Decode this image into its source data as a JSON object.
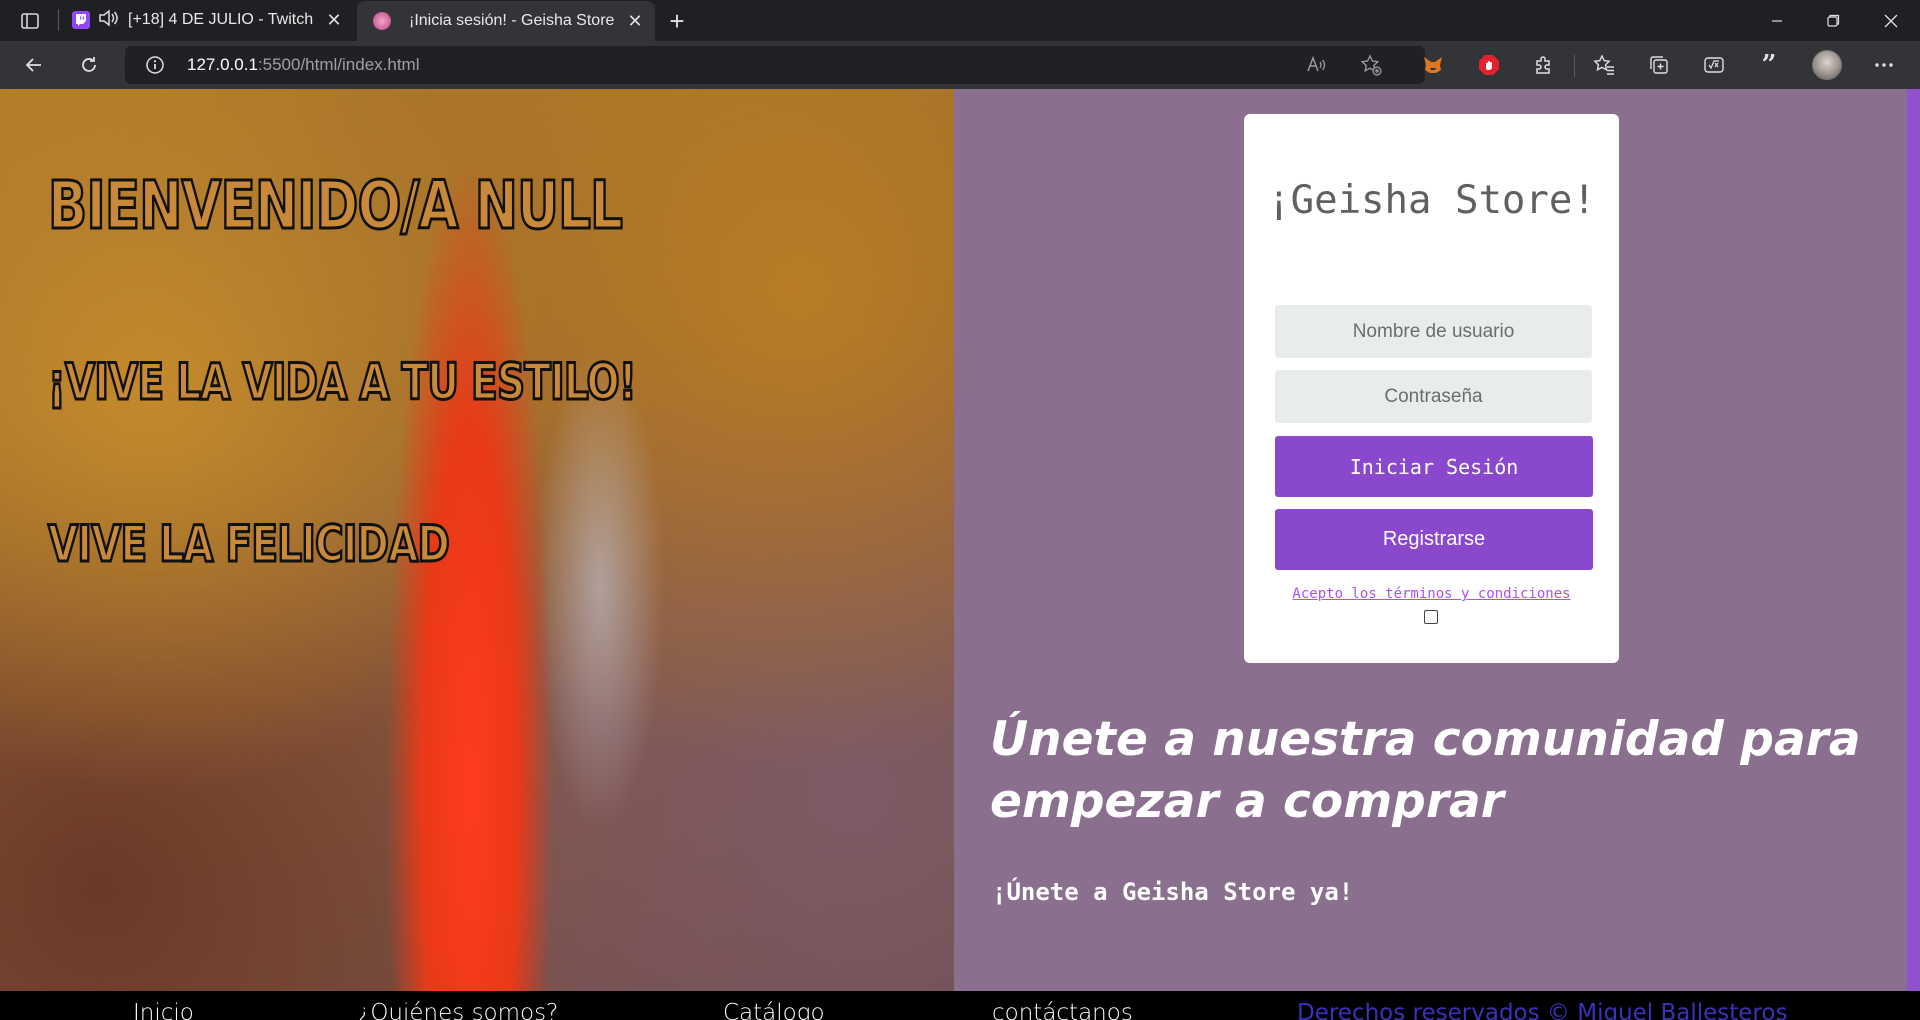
{
  "browser": {
    "tabs": [
      {
        "title": "[+18] 4 DE JULIO - Twitch",
        "favicon": "twitch-icon",
        "audio": true,
        "active": false
      },
      {
        "title": "¡Inicia sesión! - Geisha Store",
        "favicon": "geisha-store-favicon",
        "active": true
      }
    ],
    "address": {
      "host": "127.0.0.1",
      "rest": ":5500/html/index.html"
    },
    "colors": {
      "chrome_bg": "#1f2023",
      "toolbar_bg": "#333437",
      "address_bg": "#202124"
    }
  },
  "hero": {
    "line1": "BIENVENIDO/A NULL",
    "line2": "¡VIVE LA VIDA A TU ESTILO!",
    "line3": "VIVE LA FELICIDAD"
  },
  "login": {
    "brand": "¡Geisha Store!",
    "username_placeholder": "Nombre de usuario",
    "password_placeholder": "Contraseña",
    "login_label": "Iniciar Sesión",
    "register_label": "Registrarse",
    "terms_label": "Acepto los términos y condiciones",
    "terms_checked": false
  },
  "promo": {
    "heading": "Únete a nuestra comunidad para empezar a comprar",
    "subheading": "¡Únete a Geisha Store ya!"
  },
  "footer": {
    "links": [
      "Inicio",
      "¿Quiénes somos?",
      "Catálogo",
      "contáctanos"
    ],
    "copyright": "Derechos reservados © Miguel Ballesteros"
  },
  "theme": {
    "page_bg": "#8a6f8f",
    "accent": "#8a49cc",
    "stripe": "#8e52cf",
    "terms_link": "#b14ef0",
    "footer_bg": "#000000",
    "copyright_color": "#3a32b8"
  }
}
